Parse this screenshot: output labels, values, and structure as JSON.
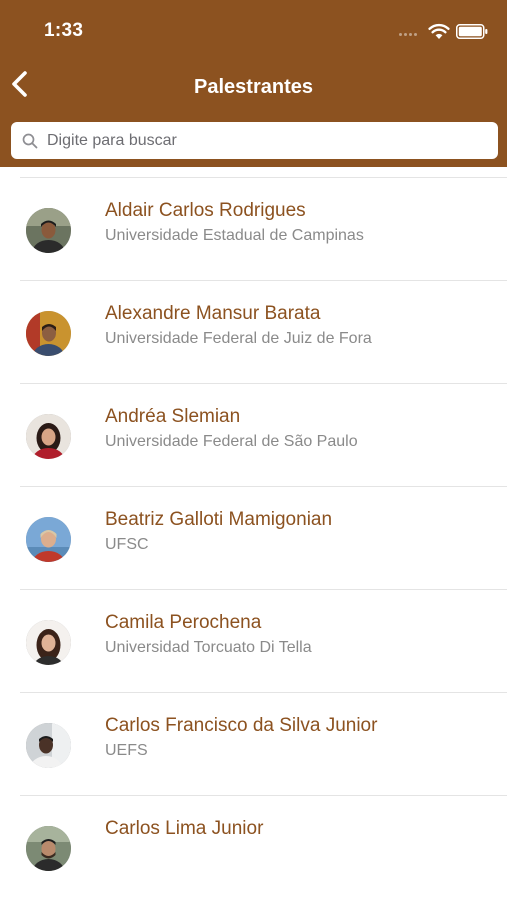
{
  "status": {
    "time": "1:33"
  },
  "nav": {
    "title": "Palestrantes"
  },
  "search": {
    "placeholder": "Digite para buscar"
  },
  "speakers": [
    {
      "name": "Aldair Carlos Rodrigues",
      "affiliation": "Universidade Estadual de Campinas"
    },
    {
      "name": "Alexandre Mansur Barata",
      "affiliation": "Universidade Federal de Juiz de Fora"
    },
    {
      "name": "Andréa Slemian",
      "affiliation": "Universidade Federal de São Paulo"
    },
    {
      "name": "Beatriz Galloti Mamigonian",
      "affiliation": "UFSC"
    },
    {
      "name": "Camila Perochena",
      "affiliation": "Universidad Torcuato Di Tella"
    },
    {
      "name": "Carlos Francisco da Silva Junior",
      "affiliation": "UEFS"
    },
    {
      "name": "Carlos Lima Junior",
      "affiliation": ""
    }
  ],
  "colors": {
    "header": "#8c5220",
    "name_text": "#8c5220",
    "subtitle_text": "#8a8a8a"
  }
}
